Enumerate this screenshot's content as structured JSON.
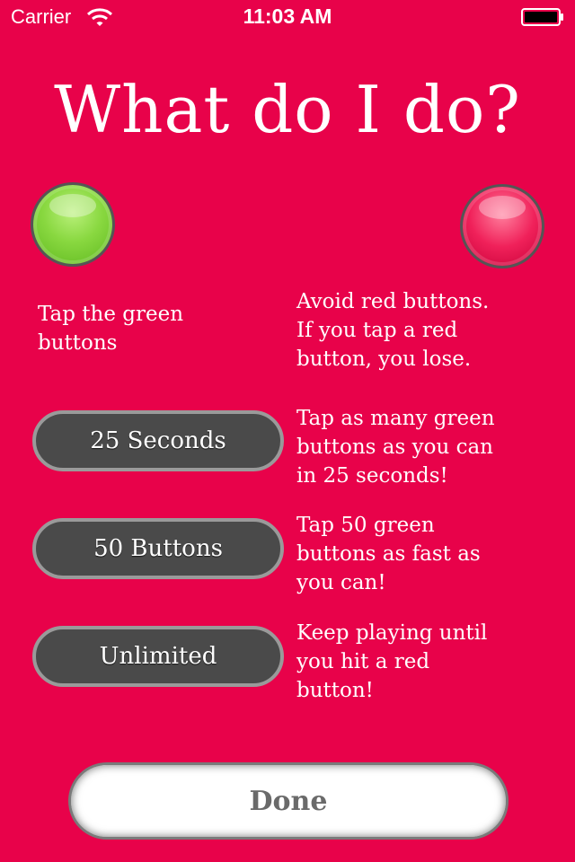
{
  "status_bar": {
    "carrier": "Carrier",
    "time": "11:03 AM",
    "icons": [
      "wifi-icon",
      "battery-icon"
    ]
  },
  "title": "What do I do?",
  "orbs": {
    "green": "green-orb-icon",
    "red": "red-orb-icon"
  },
  "instructions": {
    "green": [
      "Tap the green",
      "buttons"
    ],
    "red": [
      "Avoid red buttons.",
      "If you tap a red",
      "button, you lose."
    ]
  },
  "modes": [
    {
      "label": "25 Seconds",
      "description": [
        "Tap as many green",
        "buttons as you can",
        "in 25 seconds!"
      ]
    },
    {
      "label": "50 Buttons",
      "description": [
        "Tap 50 green",
        "buttons as fast as",
        "you can!"
      ]
    },
    {
      "label": "Unlimited",
      "description": [
        "Keep playing until",
        "you hit a red",
        "button!"
      ]
    }
  ],
  "done_label": "Done",
  "colors": {
    "background": "#e8024a",
    "pill": "#4a4a4a",
    "pill_border": "#9a9a9a",
    "text": "#ffffff"
  }
}
